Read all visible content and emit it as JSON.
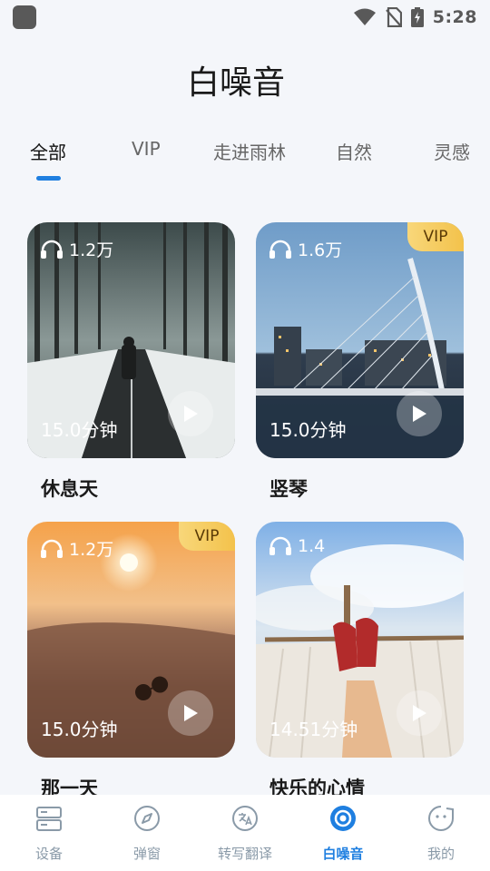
{
  "status_bar": {
    "time": "5:28"
  },
  "page": {
    "title": "白噪音"
  },
  "tabs": [
    {
      "label": "全部"
    },
    {
      "label": "VIP"
    },
    {
      "label": "走进雨林"
    },
    {
      "label": "自然"
    },
    {
      "label": "灵感"
    }
  ],
  "active_tab": "全部",
  "cards": [
    {
      "title": "休息天",
      "plays": "1.2万",
      "duration": "15.0分钟",
      "vip": false
    },
    {
      "title": "竖琴",
      "plays": "1.6万",
      "duration": "15.0分钟",
      "vip": true,
      "vip_label": "VIP"
    },
    {
      "title": "那一天",
      "plays": "1.2万",
      "duration": "15.0分钟",
      "vip": true,
      "vip_label": "VIP"
    },
    {
      "title": "快乐的心情",
      "plays": "1.4",
      "duration": "14.51分钟",
      "vip": false
    }
  ],
  "bottom_nav": [
    {
      "label": "设备",
      "icon": "device-icon"
    },
    {
      "label": "弹窗",
      "icon": "compass-icon"
    },
    {
      "label": "转写翻译",
      "icon": "translate-icon"
    },
    {
      "label": "白噪音",
      "icon": "white-noise-icon"
    },
    {
      "label": "我的",
      "icon": "profile-face-icon"
    }
  ],
  "active_nav": "白噪音",
  "colors": {
    "accent": "#1f7fe0",
    "vip_badge": "#f3c24b",
    "nav_inactive": "#8a9aa8",
    "background": "#f4f6fa"
  }
}
